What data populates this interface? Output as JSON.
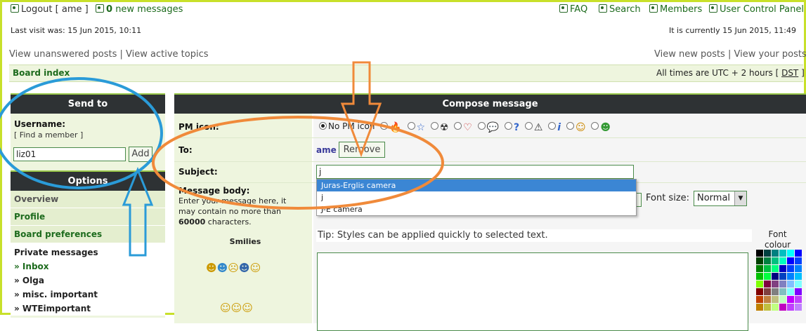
{
  "topbar": {
    "logout": "Logout [ ame ]",
    "new_count": "0",
    "new_messages": "new messages",
    "faq": "FAQ",
    "search": "Search",
    "members": "Members",
    "ucp": "User Control Panel"
  },
  "info": {
    "last_visit": "Last visit was: 15 Jun 2015, 10:11",
    "current": "It is currently 15 Jun 2015, 11:49"
  },
  "links": {
    "unanswered": "View unanswered posts",
    "sep": "|",
    "active": "View active topics",
    "new_posts": "View new posts",
    "your_posts": "View your posts"
  },
  "breadcrumb": {
    "board_index": "Board index",
    "timezone_prefix": "All times are UTC + 2 hours [",
    "dst": "DST",
    "timezone_suffix": "]"
  },
  "sendto": {
    "header": "Send to",
    "username_label": "Username:",
    "find_member_open": "[",
    "find_member": "Find a member",
    "find_member_close": "]",
    "username_value": "liz01",
    "add_label": "Add"
  },
  "options": {
    "header": "Options",
    "items": [
      "Overview",
      "Profile",
      "Board preferences"
    ],
    "private_messages": "Private messages",
    "folders": [
      "» Inbox",
      "» Olga",
      "» misc. important",
      "» WTEimportant"
    ]
  },
  "compose": {
    "header": "Compose message",
    "pm_icon_label": "PM icon:",
    "no_pm_icon": "No PM icon",
    "to_label": "To:",
    "recipient": "ame",
    "remove_label": "Remove",
    "subject_label": "Subject:",
    "subject_value": "j",
    "autocomplete": [
      "Juras-Erglis camera",
      "j",
      "J-E camera"
    ],
    "body_label": "Message body:",
    "body_hint_1": "Enter your message here, it",
    "body_hint_2": "may contain no more than",
    "body_limit": "60000",
    "body_hint_3": "characters.",
    "smilies": "Smilies",
    "font_size_label": "Font size:",
    "font_size_value": "Normal",
    "tip": "Tip: Styles can be applied quickly to selected text.",
    "font_colour_1": "Font",
    "font_colour_2": "colour"
  },
  "pm_icons": [
    "🔥",
    "☆",
    "☢",
    "♡",
    "💬",
    "?",
    "⚠",
    "i",
    "☺",
    "☻"
  ],
  "colors": {
    "accent_green": "#1d6b1d",
    "header_dark": "#2e3234",
    "annotation_blue": "#2a9bd8",
    "annotation_orange": "#f08a3a",
    "frame": "#c8e02a"
  }
}
